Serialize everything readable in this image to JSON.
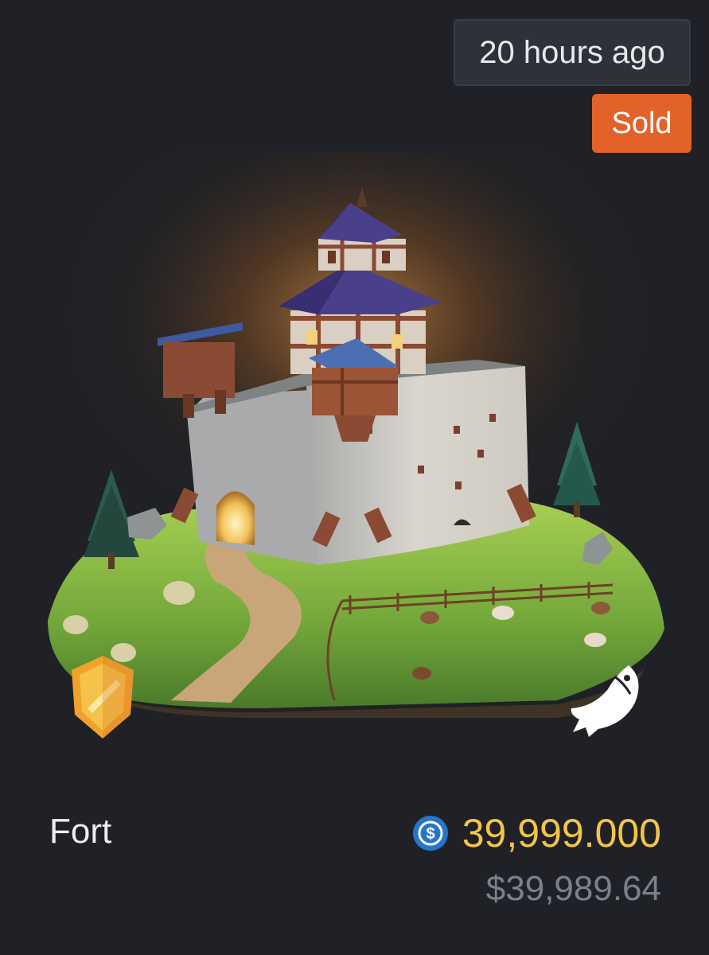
{
  "listing": {
    "time_ago": "20 hours ago",
    "status": "Sold",
    "name": "Fort",
    "price": "39,999.000",
    "price_usd": "$39,989.64",
    "currency_icon": "usdc-coin-icon",
    "rarity_icon": "gold-shield-icon",
    "category_icon": "fish-icon",
    "image": "fort-castle-illustration"
  },
  "colors": {
    "background": "#1f2126",
    "sold_badge": "#e2622a",
    "price": "#f3c547",
    "usd_secondary": "#7c8089",
    "usdc_blue": "#2775ca"
  }
}
